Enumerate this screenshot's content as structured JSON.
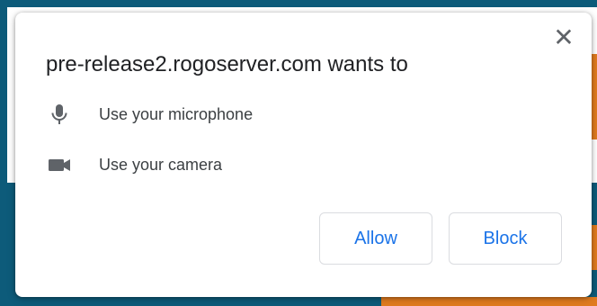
{
  "dialog": {
    "title": "pre-release2.rogoserver.com wants to",
    "close_icon": "close-icon",
    "permissions": [
      {
        "icon": "microphone-icon",
        "label": "Use your microphone"
      },
      {
        "icon": "camera-icon",
        "label": "Use your camera"
      }
    ],
    "buttons": {
      "allow_label": "Allow",
      "block_label": "Block"
    },
    "colors": {
      "accent": "#1a73e8",
      "title_text": "#202124",
      "icon": "#5f6368",
      "background_band": "#0d5b7a",
      "background_orange": "#e07b1f"
    }
  }
}
